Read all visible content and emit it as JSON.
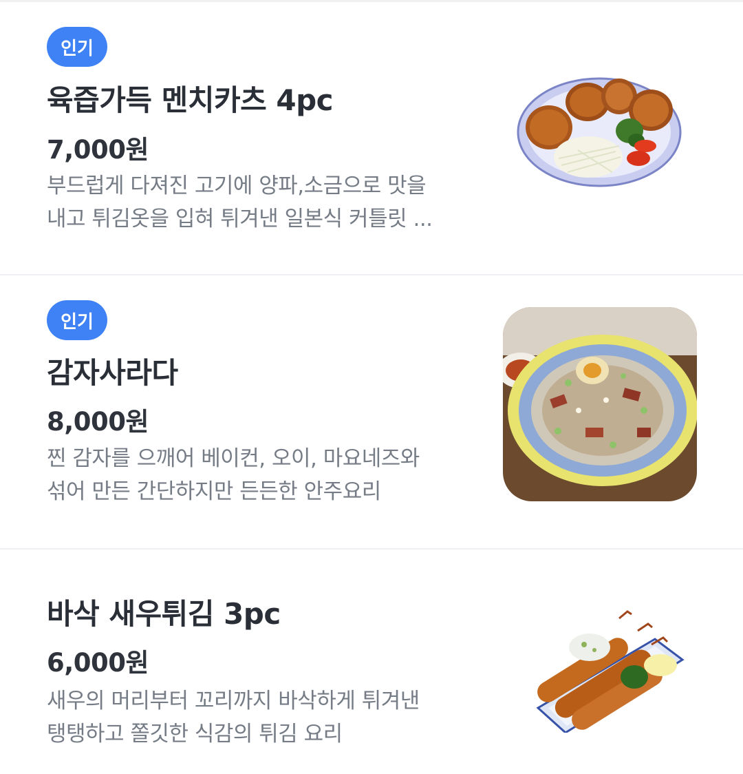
{
  "menu": {
    "items": [
      {
        "badge": "인기",
        "name": "육즙가득 멘치카츠 4pc",
        "price": "7,000원",
        "desc_line1": "부드럽게 다져진 고기에 양파,소금으로 맛을",
        "desc_line2": "내고 튀김옷을 입혀 튀겨낸 일본식 커틀릿 ..."
      },
      {
        "badge": "인기",
        "name": "감자사라다",
        "price": "8,000원",
        "desc_line1": "찐 감자를 으깨어 베이컨, 오이, 마요네즈와",
        "desc_line2": "섞어 만든 간단하지만 든든한 안주요리"
      },
      {
        "name": "바삭 새우튀김 3pc",
        "price": "6,000원",
        "desc_line1": "새우의 머리부터 꼬리까지 바삭하게 튀겨낸",
        "desc_line2": "탱탱하고 쫄깃한 식감의 튀김 요리"
      }
    ]
  },
  "colors": {
    "badge_bg": "#3f82f5",
    "text_primary": "#2a2f37",
    "text_secondary": "#757c86",
    "divider": "#eef0f3"
  }
}
